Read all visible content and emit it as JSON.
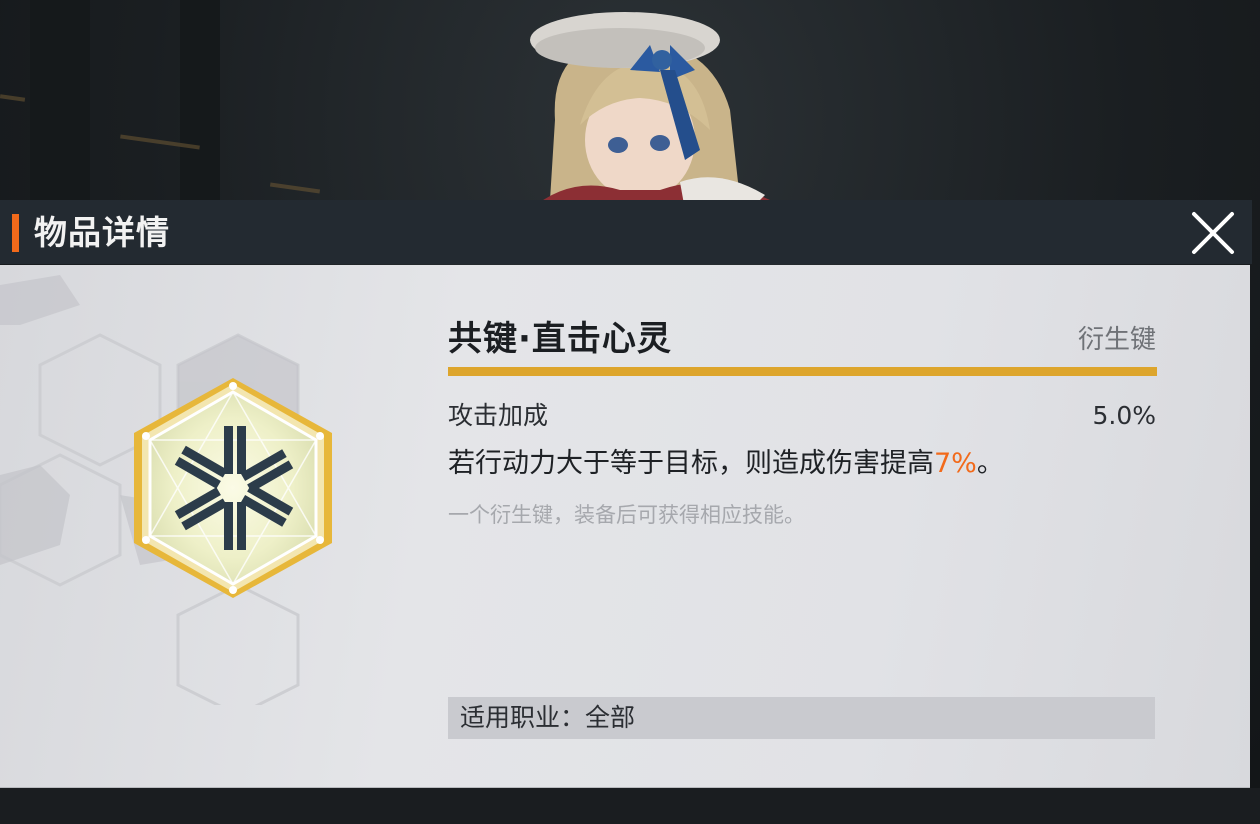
{
  "header": {
    "title": "物品详情"
  },
  "item": {
    "name": "共键·直击心灵",
    "type": "衍生键",
    "stat_label": "攻击加成",
    "stat_value": "5.0%",
    "effect_prefix": "若行动力大于等于目标，则造成伤害提高",
    "effect_highlight": "7%",
    "effect_suffix": "。",
    "description": "一个衍生键，装备后可获得相应技能。",
    "class_restriction": "适用职业：全部"
  },
  "colors": {
    "accent_orange": "#f26a1b",
    "gold": "#dda52c",
    "header_bg": "#232a31"
  },
  "icons": {
    "close": "close-icon",
    "emblem": "keystone-emblem-icon"
  }
}
